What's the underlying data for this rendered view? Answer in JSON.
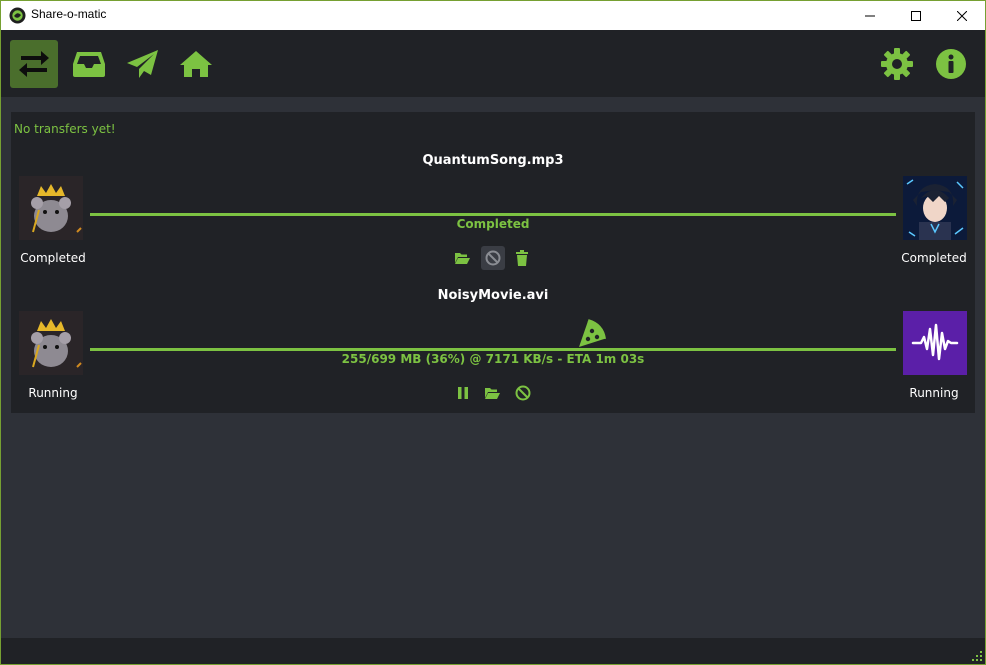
{
  "window": {
    "title": "Share-o-matic",
    "controls": {
      "minimize": "minimize",
      "maximize": "maximize",
      "close": "close"
    }
  },
  "toolbar": {
    "left": [
      {
        "icon": "transfers-icon",
        "active": true
      },
      {
        "icon": "inbox-icon",
        "active": false
      },
      {
        "icon": "send-icon",
        "active": false
      },
      {
        "icon": "home-icon",
        "active": false
      }
    ],
    "right": [
      {
        "icon": "gear-icon"
      },
      {
        "icon": "info-icon"
      }
    ]
  },
  "transfers": {
    "empty_note": "No transfers yet!",
    "items": [
      {
        "filename": "QuantumSong.mp3",
        "sender_status": "Completed",
        "receiver_status": "Completed",
        "progress_status": "Completed",
        "progress": 1.0,
        "actions": [
          "open-folder-icon",
          "cancel-icon",
          "delete-icon"
        ]
      },
      {
        "filename": "NoisyMovie.avi",
        "sender_status": "Running",
        "receiver_status": "Running",
        "progress_status": "255/699 MB (36%) @ 7171 KB/s - ETA 1m 03s",
        "progress": 0.36,
        "actions": [
          "pause-icon",
          "open-folder-icon",
          "cancel-icon"
        ]
      }
    ]
  },
  "colors": {
    "accent": "#7cc242",
    "toolbar_bg": "#202226",
    "window_bg": "#2e3138",
    "active_tab_bg": "#4a6e2c",
    "receiver_avatar_purple": "#5b1fa8"
  }
}
